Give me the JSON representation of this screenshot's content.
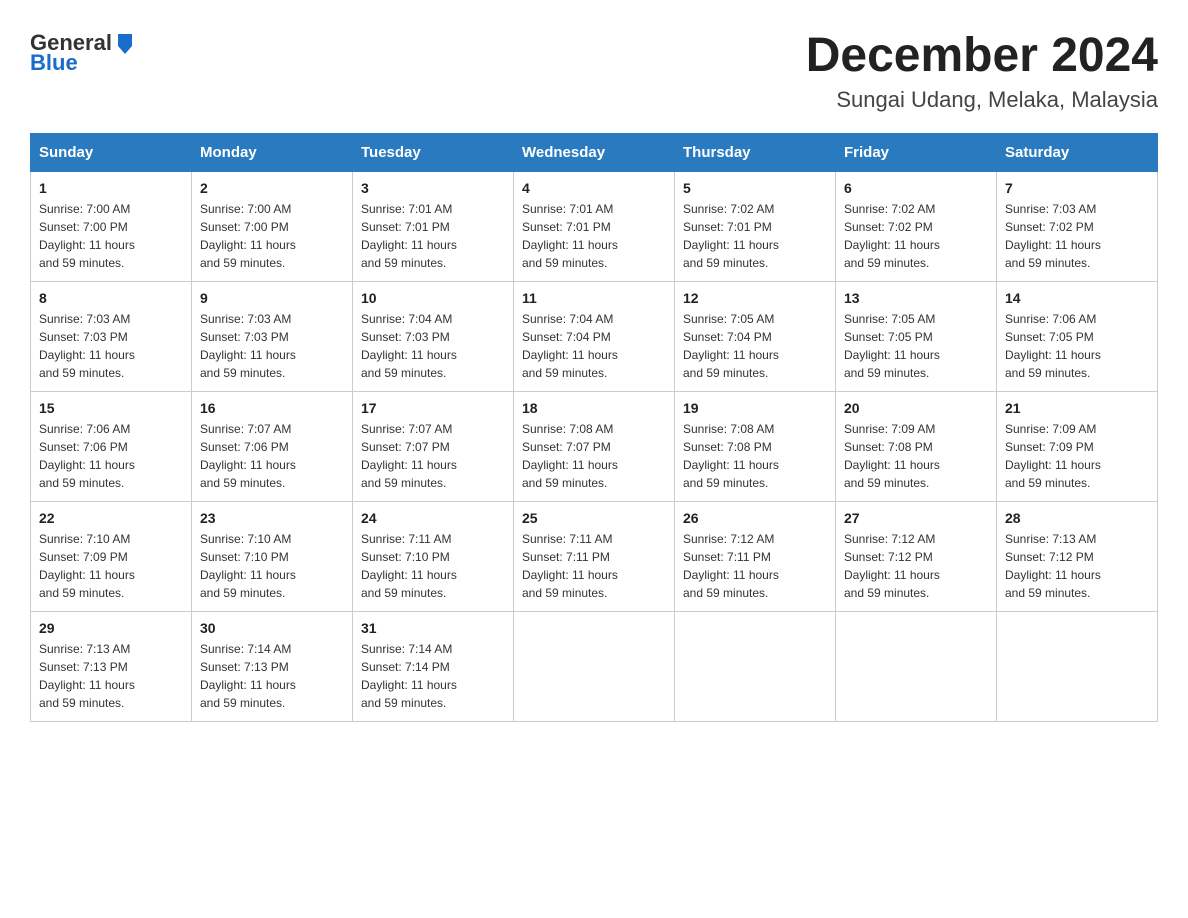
{
  "header": {
    "logo_general": "General",
    "logo_blue": "Blue",
    "month_title": "December 2024",
    "location": "Sungai Udang, Melaka, Malaysia"
  },
  "weekdays": [
    "Sunday",
    "Monday",
    "Tuesday",
    "Wednesday",
    "Thursday",
    "Friday",
    "Saturday"
  ],
  "weeks": [
    [
      {
        "day": "1",
        "sunrise": "7:00 AM",
        "sunset": "7:00 PM",
        "daylight": "11 hours and 59 minutes."
      },
      {
        "day": "2",
        "sunrise": "7:00 AM",
        "sunset": "7:00 PM",
        "daylight": "11 hours and 59 minutes."
      },
      {
        "day": "3",
        "sunrise": "7:01 AM",
        "sunset": "7:01 PM",
        "daylight": "11 hours and 59 minutes."
      },
      {
        "day": "4",
        "sunrise": "7:01 AM",
        "sunset": "7:01 PM",
        "daylight": "11 hours and 59 minutes."
      },
      {
        "day": "5",
        "sunrise": "7:02 AM",
        "sunset": "7:01 PM",
        "daylight": "11 hours and 59 minutes."
      },
      {
        "day": "6",
        "sunrise": "7:02 AM",
        "sunset": "7:02 PM",
        "daylight": "11 hours and 59 minutes."
      },
      {
        "day": "7",
        "sunrise": "7:03 AM",
        "sunset": "7:02 PM",
        "daylight": "11 hours and 59 minutes."
      }
    ],
    [
      {
        "day": "8",
        "sunrise": "7:03 AM",
        "sunset": "7:03 PM",
        "daylight": "11 hours and 59 minutes."
      },
      {
        "day": "9",
        "sunrise": "7:03 AM",
        "sunset": "7:03 PM",
        "daylight": "11 hours and 59 minutes."
      },
      {
        "day": "10",
        "sunrise": "7:04 AM",
        "sunset": "7:03 PM",
        "daylight": "11 hours and 59 minutes."
      },
      {
        "day": "11",
        "sunrise": "7:04 AM",
        "sunset": "7:04 PM",
        "daylight": "11 hours and 59 minutes."
      },
      {
        "day": "12",
        "sunrise": "7:05 AM",
        "sunset": "7:04 PM",
        "daylight": "11 hours and 59 minutes."
      },
      {
        "day": "13",
        "sunrise": "7:05 AM",
        "sunset": "7:05 PM",
        "daylight": "11 hours and 59 minutes."
      },
      {
        "day": "14",
        "sunrise": "7:06 AM",
        "sunset": "7:05 PM",
        "daylight": "11 hours and 59 minutes."
      }
    ],
    [
      {
        "day": "15",
        "sunrise": "7:06 AM",
        "sunset": "7:06 PM",
        "daylight": "11 hours and 59 minutes."
      },
      {
        "day": "16",
        "sunrise": "7:07 AM",
        "sunset": "7:06 PM",
        "daylight": "11 hours and 59 minutes."
      },
      {
        "day": "17",
        "sunrise": "7:07 AM",
        "sunset": "7:07 PM",
        "daylight": "11 hours and 59 minutes."
      },
      {
        "day": "18",
        "sunrise": "7:08 AM",
        "sunset": "7:07 PM",
        "daylight": "11 hours and 59 minutes."
      },
      {
        "day": "19",
        "sunrise": "7:08 AM",
        "sunset": "7:08 PM",
        "daylight": "11 hours and 59 minutes."
      },
      {
        "day": "20",
        "sunrise": "7:09 AM",
        "sunset": "7:08 PM",
        "daylight": "11 hours and 59 minutes."
      },
      {
        "day": "21",
        "sunrise": "7:09 AM",
        "sunset": "7:09 PM",
        "daylight": "11 hours and 59 minutes."
      }
    ],
    [
      {
        "day": "22",
        "sunrise": "7:10 AM",
        "sunset": "7:09 PM",
        "daylight": "11 hours and 59 minutes."
      },
      {
        "day": "23",
        "sunrise": "7:10 AM",
        "sunset": "7:10 PM",
        "daylight": "11 hours and 59 minutes."
      },
      {
        "day": "24",
        "sunrise": "7:11 AM",
        "sunset": "7:10 PM",
        "daylight": "11 hours and 59 minutes."
      },
      {
        "day": "25",
        "sunrise": "7:11 AM",
        "sunset": "7:11 PM",
        "daylight": "11 hours and 59 minutes."
      },
      {
        "day": "26",
        "sunrise": "7:12 AM",
        "sunset": "7:11 PM",
        "daylight": "11 hours and 59 minutes."
      },
      {
        "day": "27",
        "sunrise": "7:12 AM",
        "sunset": "7:12 PM",
        "daylight": "11 hours and 59 minutes."
      },
      {
        "day": "28",
        "sunrise": "7:13 AM",
        "sunset": "7:12 PM",
        "daylight": "11 hours and 59 minutes."
      }
    ],
    [
      {
        "day": "29",
        "sunrise": "7:13 AM",
        "sunset": "7:13 PM",
        "daylight": "11 hours and 59 minutes."
      },
      {
        "day": "30",
        "sunrise": "7:14 AM",
        "sunset": "7:13 PM",
        "daylight": "11 hours and 59 minutes."
      },
      {
        "day": "31",
        "sunrise": "7:14 AM",
        "sunset": "7:14 PM",
        "daylight": "11 hours and 59 minutes."
      },
      null,
      null,
      null,
      null
    ]
  ],
  "labels": {
    "sunrise": "Sunrise:",
    "sunset": "Sunset:",
    "daylight": "Daylight:"
  }
}
